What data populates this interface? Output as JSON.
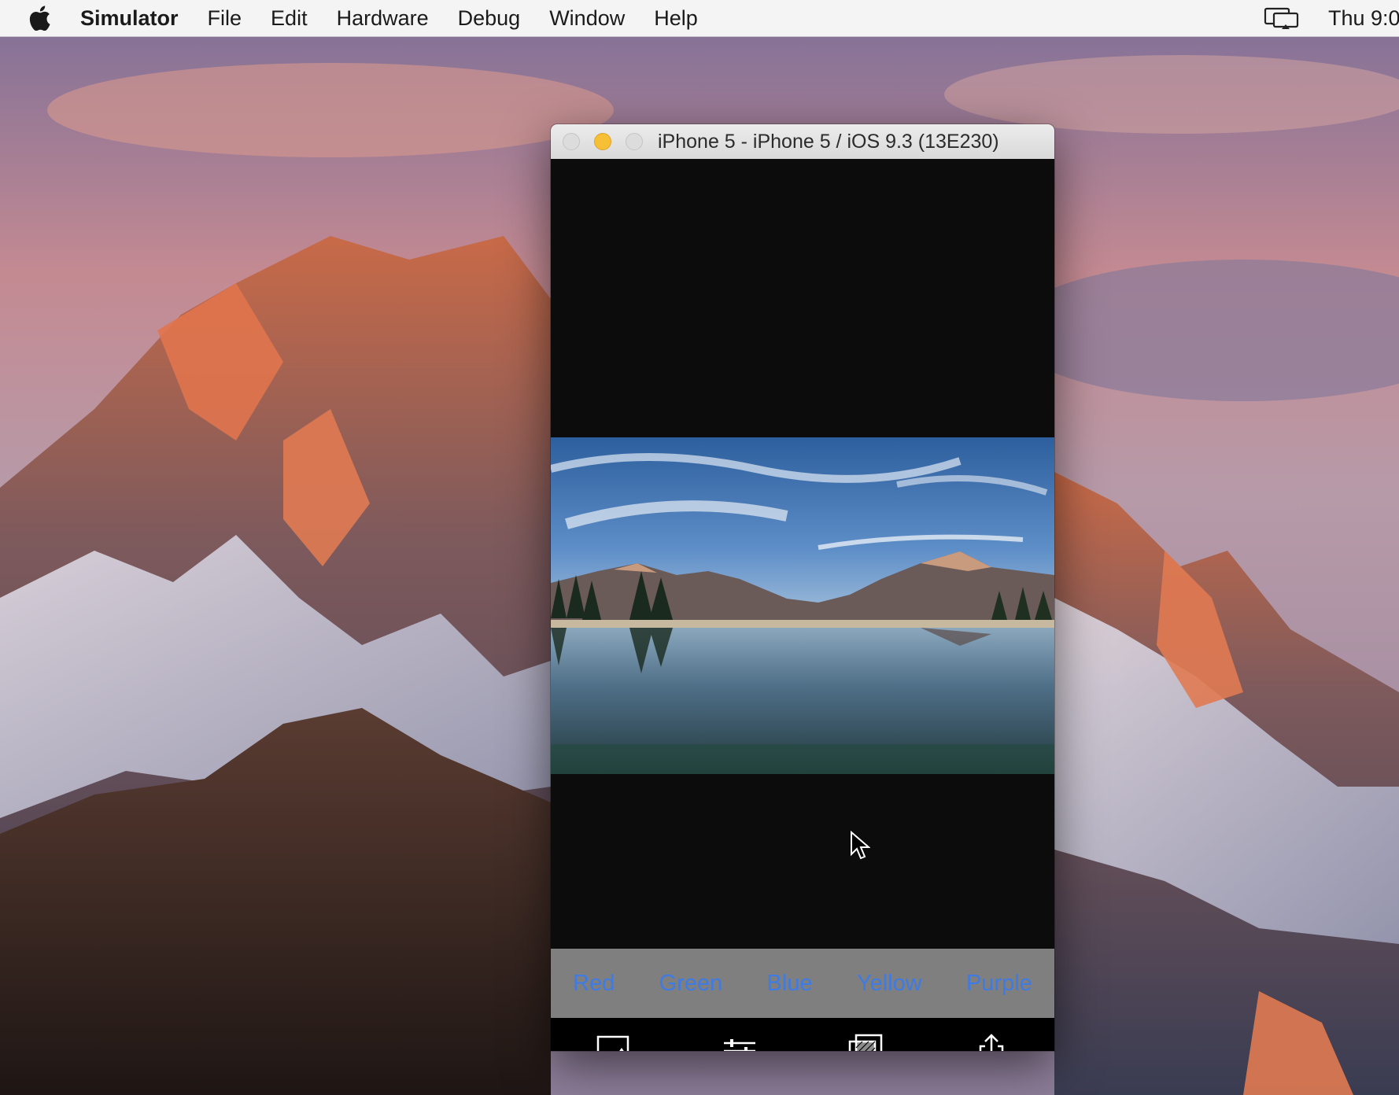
{
  "menubar": {
    "app_name": "Simulator",
    "items": [
      "File",
      "Edit",
      "Hardware",
      "Debug",
      "Window",
      "Help"
    ],
    "clock": "Thu 9:0",
    "icons": [
      "apple-logo-icon",
      "airplay-display-icon"
    ]
  },
  "window": {
    "title": "iPhone 5 - iPhone 5 / iOS 9.3 (13E230)"
  },
  "app": {
    "color_buttons": [
      "Red",
      "Green",
      "Blue",
      "Yellow",
      "Purple"
    ],
    "button_color": "#3d7be6",
    "toolbar_icons": [
      "photo-icon",
      "adjustments-icon",
      "filter-layers-icon",
      "share-icon"
    ]
  }
}
